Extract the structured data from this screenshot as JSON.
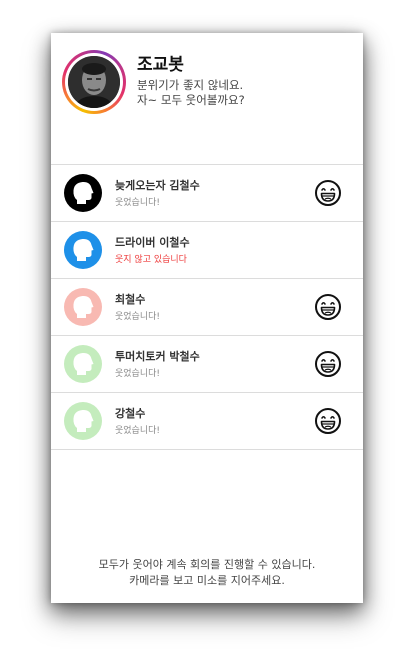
{
  "host": {
    "name": "조교봇",
    "message_line1": "분위기가 좋지 않네요.",
    "message_line2": "자~ 모두 웃어볼까요?"
  },
  "participants": [
    {
      "name": "늦게오는자 김철수",
      "status": "웃었습니다!",
      "avatar_color": "#000000",
      "smiling": true
    },
    {
      "name": "드라이버 이철수",
      "status": "웃지 않고 있습니다",
      "avatar_color": "#1e90e8",
      "smiling": false
    },
    {
      "name": "최철수",
      "status": "웃었습니다!",
      "avatar_color": "#f8b9b2",
      "smiling": true
    },
    {
      "name": "투머치토커 박철수",
      "status": "웃었습니다!",
      "avatar_color": "#c4ecbd",
      "smiling": true
    },
    {
      "name": "강철수",
      "status": "웃었습니다!",
      "avatar_color": "#c4ecbd",
      "smiling": true
    }
  ],
  "footer": {
    "line1": "모두가 웃어야 계속 회의를 진행할 수 있습니다.",
    "line2": "카메라를 보고 미소를 지어주세요."
  },
  "icons": {
    "participant_avatar": "person-silhouette-icon",
    "smiling": "laughing-face-icon"
  },
  "colors": {
    "not_smiling_status": "#ee3b3b"
  }
}
